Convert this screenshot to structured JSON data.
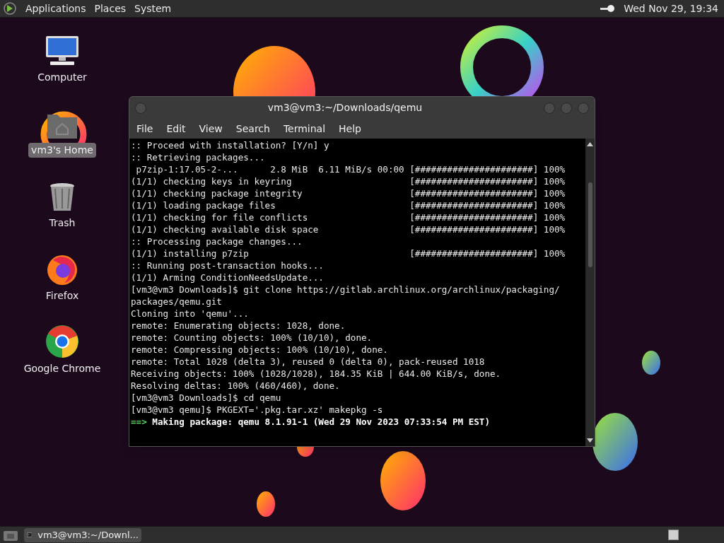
{
  "top_panel": {
    "menus": [
      "Applications",
      "Places",
      "System"
    ],
    "clock": "Wed Nov 29, 19:34"
  },
  "desktop_icons": [
    {
      "kind": "computer",
      "label": "Computer",
      "selected": false
    },
    {
      "kind": "home",
      "label": "vm3's Home",
      "selected": true
    },
    {
      "kind": "trash",
      "label": "Trash",
      "selected": false
    },
    {
      "kind": "firefox",
      "label": "Firefox",
      "selected": false
    },
    {
      "kind": "chrome",
      "label": "Google Chrome",
      "selected": false
    }
  ],
  "terminal": {
    "title": "vm3@vm3:~/Downloads/qemu",
    "menus": [
      "File",
      "Edit",
      "View",
      "Search",
      "Terminal",
      "Help"
    ],
    "lines": [
      {
        "kind": "plain",
        "text": ":: Proceed with installation? [Y/n] y"
      },
      {
        "kind": "plain",
        "text": ":: Retrieving packages..."
      },
      {
        "kind": "progress",
        "text": " p7zip-1:17.05-2-...      2.8 MiB  6.11 MiB/s 00:00",
        "bar": "[######################] 100%"
      },
      {
        "kind": "progress",
        "text": "(1/1) checking keys in keyring",
        "bar": "[######################] 100%"
      },
      {
        "kind": "progress",
        "text": "(1/1) checking package integrity",
        "bar": "[######################] 100%"
      },
      {
        "kind": "progress",
        "text": "(1/1) loading package files",
        "bar": "[######################] 100%"
      },
      {
        "kind": "progress",
        "text": "(1/1) checking for file conflicts",
        "bar": "[######################] 100%"
      },
      {
        "kind": "progress",
        "text": "(1/1) checking available disk space",
        "bar": "[######################] 100%"
      },
      {
        "kind": "plain",
        "text": ":: Processing package changes..."
      },
      {
        "kind": "progress",
        "text": "(1/1) installing p7zip",
        "bar": "[######################] 100%"
      },
      {
        "kind": "plain",
        "text": ":: Running post-transaction hooks..."
      },
      {
        "kind": "plain",
        "text": "(1/1) Arming ConditionNeedsUpdate..."
      },
      {
        "kind": "plain",
        "text": "[vm3@vm3 Downloads]$ git clone https://gitlab.archlinux.org/archlinux/packaging/"
      },
      {
        "kind": "plain",
        "text": "packages/qemu.git"
      },
      {
        "kind": "plain",
        "text": "Cloning into 'qemu'..."
      },
      {
        "kind": "plain",
        "text": "remote: Enumerating objects: 1028, done."
      },
      {
        "kind": "plain",
        "text": "remote: Counting objects: 100% (10/10), done."
      },
      {
        "kind": "plain",
        "text": "remote: Compressing objects: 100% (10/10), done."
      },
      {
        "kind": "plain",
        "text": "remote: Total 1028 (delta 3), reused 0 (delta 0), pack-reused 1018"
      },
      {
        "kind": "plain",
        "text": "Receiving objects: 100% (1028/1028), 184.35 KiB | 644.00 KiB/s, done."
      },
      {
        "kind": "plain",
        "text": "Resolving deltas: 100% (460/460), done."
      },
      {
        "kind": "plain",
        "text": "[vm3@vm3 Downloads]$ cd qemu"
      },
      {
        "kind": "plain",
        "text": "[vm3@vm3 qemu]$ PKGEXT='.pkg.tar.xz' makepkg -s"
      },
      {
        "kind": "heading",
        "prefix": "==>",
        "text": "Making package: qemu 8.1.91-1 (Wed 29 Nov 2023 07:33:54 PM EST)"
      }
    ]
  },
  "taskbar": {
    "tasks": [
      {
        "label": "vm3@vm3:~/Downl...",
        "selected": false
      }
    ]
  }
}
